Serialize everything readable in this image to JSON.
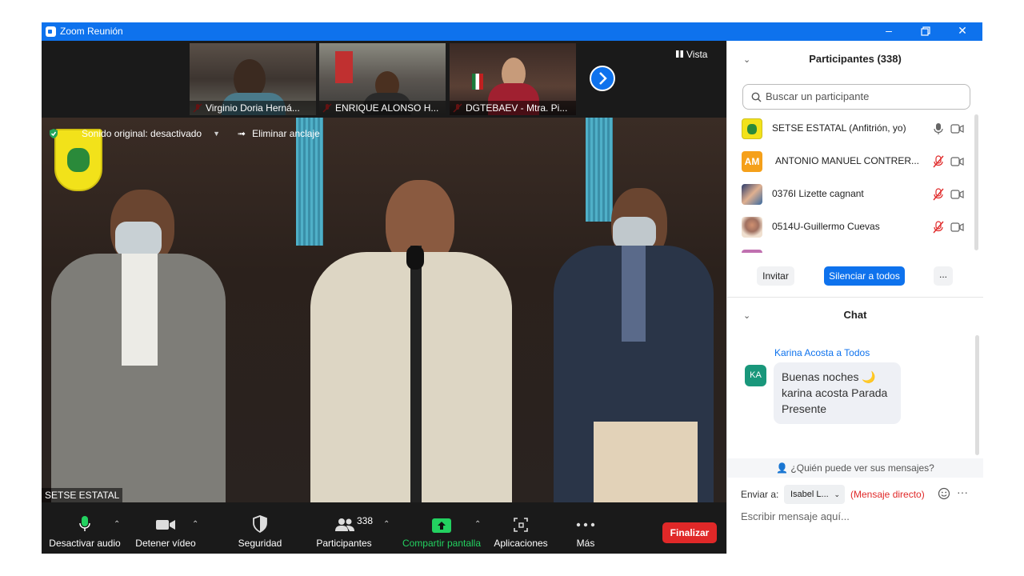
{
  "window": {
    "title": "Zoom Reunión"
  },
  "thumbnails": [
    {
      "name": "Virginio Doria Herná..."
    },
    {
      "name": "ENRIQUE ALONSO H..."
    },
    {
      "name": "DGTEBAEV - Mtra. Pi..."
    }
  ],
  "view_label": "Vista",
  "main_video": {
    "sound_label": "Sonido original: desactivado",
    "unpin_label": "Eliminar anclaje",
    "speaker_name": "SETSE ESTATAL"
  },
  "toolbar": {
    "mute": "Desactivar audio",
    "video": "Detener vídeo",
    "security": "Seguridad",
    "participants": "Participantes",
    "participants_count": "338",
    "share": "Compartir pantalla",
    "apps": "Aplicaciones",
    "more": "Más",
    "end": "Finalizar"
  },
  "panel": {
    "participants_title": "Participantes (338)",
    "search_placeholder": "Buscar un participante",
    "participants": [
      {
        "name": "SETSE ESTATAL (Anfitrión, yo)",
        "initials": ""
      },
      {
        "name": "ANTONIO MANUEL CONTRER...",
        "initials": "AM"
      },
      {
        "name": "0376I Lizette cagnant",
        "initials": ""
      },
      {
        "name": "0514U-Guillermo Cuevas",
        "initials": ""
      }
    ],
    "invite": "Invitar",
    "mute_all": "Silenciar a todos",
    "more_btn": "...",
    "chat_title": "Chat",
    "chat": {
      "sender": "Karina Acosta a Todos",
      "avatar": "KA",
      "message_line1": "Buenas noches 🌙",
      "message_line2": "karina acosta Parada",
      "message_line3": "Presente"
    },
    "who_can_see": "¿Quién puede ver sus mensajes?",
    "send_to_label": "Enviar a:",
    "send_to_value": "Isabel L...",
    "direct_message": "(Mensaje directo)",
    "input_placeholder": "Escribir mensaje aquí..."
  }
}
